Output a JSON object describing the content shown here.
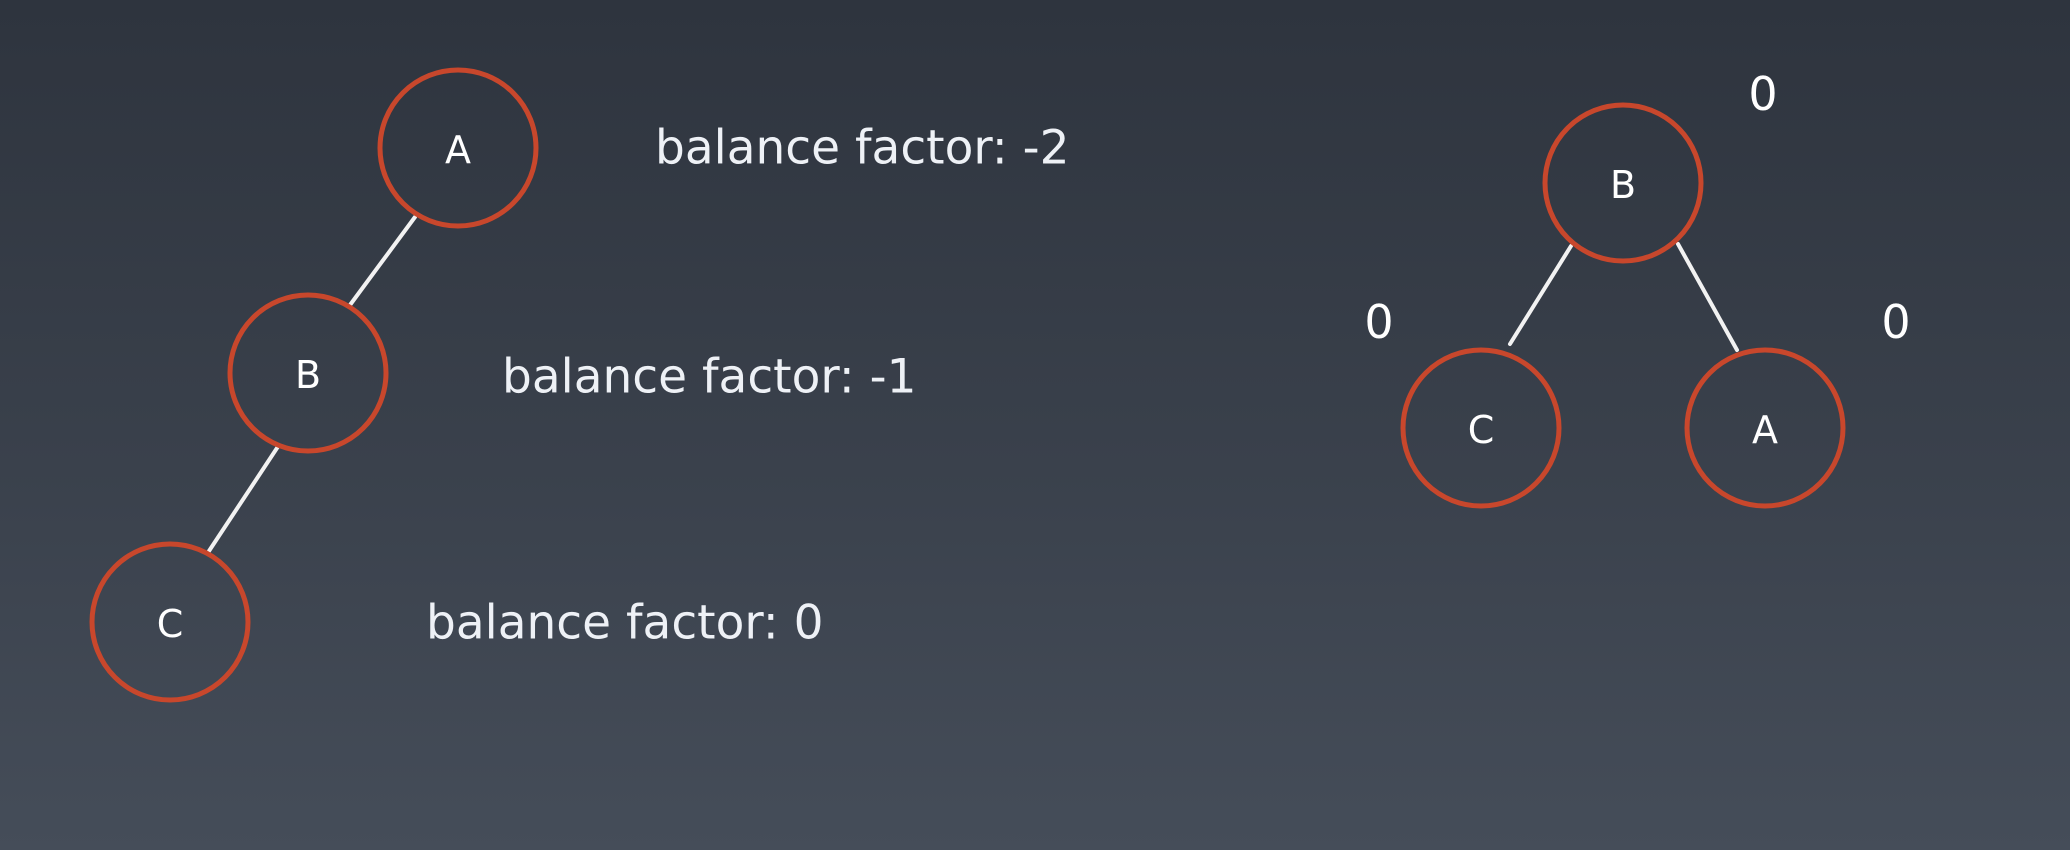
{
  "left_tree": {
    "nodes": [
      {
        "id": "A",
        "label": "A",
        "balance_text": "balance factor: -2"
      },
      {
        "id": "B",
        "label": "B",
        "balance_text": "balance factor: -1"
      },
      {
        "id": "C",
        "label": "C",
        "balance_text": "balance factor: 0"
      }
    ],
    "edges": [
      [
        "A",
        "B"
      ],
      [
        "B",
        "C"
      ]
    ]
  },
  "right_tree": {
    "nodes": [
      {
        "id": "B",
        "label": "B",
        "balance": "0"
      },
      {
        "id": "C",
        "label": "C",
        "balance": "0"
      },
      {
        "id": "A",
        "label": "A",
        "balance": "0"
      }
    ],
    "edges": [
      [
        "B",
        "C"
      ],
      [
        "B",
        "A"
      ]
    ]
  },
  "colors": {
    "node_outline": "#c8472c",
    "edge": "#f2f2f2",
    "text": "#ffffff"
  }
}
